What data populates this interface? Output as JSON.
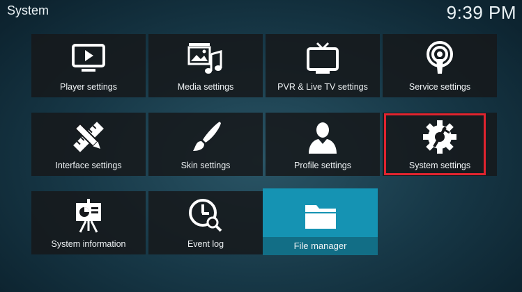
{
  "header": {
    "title": "System",
    "clock": "9:39 PM"
  },
  "tiles": [
    {
      "label": "Player settings",
      "icon": "monitor-play-icon"
    },
    {
      "label": "Media settings",
      "icon": "media-film-music-icon"
    },
    {
      "label": "PVR & Live TV settings",
      "icon": "tv-antenna-icon"
    },
    {
      "label": "Service settings",
      "icon": "podcast-broadcast-icon"
    },
    {
      "label": "Interface settings",
      "icon": "pencil-ruler-icon"
    },
    {
      "label": "Skin settings",
      "icon": "paintbrush-icon"
    },
    {
      "label": "Profile settings",
      "icon": "user-profile-icon"
    },
    {
      "label": "System settings",
      "icon": "gear-tools-icon"
    },
    {
      "label": "System information",
      "icon": "presentation-easel-icon"
    },
    {
      "label": "Event log",
      "icon": "clock-search-icon"
    },
    {
      "label": "File manager",
      "icon": "folder-icon"
    }
  ],
  "colors": {
    "focus": "#1593b3",
    "highlight": "#e0242f"
  }
}
